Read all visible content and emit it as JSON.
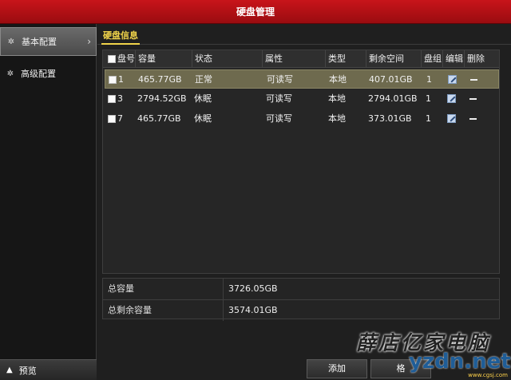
{
  "window": {
    "title": "硬盘管理"
  },
  "sidebar": {
    "items": [
      {
        "label": "基本配置",
        "active": true
      },
      {
        "label": "高级配置",
        "active": false
      }
    ],
    "preview_label": "预览"
  },
  "tabs": [
    {
      "label": "硬盘信息",
      "active": true
    }
  ],
  "table": {
    "headers": {
      "disk_no": "盘号",
      "capacity": "容量",
      "status": "状态",
      "attribute": "属性",
      "type": "类型",
      "free_space": "剩余空间",
      "group": "盘组",
      "edit": "编辑",
      "delete": "删除"
    },
    "rows": [
      {
        "disk_no": "1",
        "capacity": "465.77GB",
        "status": "正常",
        "attribute": "可读写",
        "type": "本地",
        "free_space": "407.01GB",
        "group": "1",
        "selected": true
      },
      {
        "disk_no": "3",
        "capacity": "2794.52GB",
        "status": "休眠",
        "attribute": "可读写",
        "type": "本地",
        "free_space": "2794.01GB",
        "group": "1",
        "selected": false
      },
      {
        "disk_no": "7",
        "capacity": "465.77GB",
        "status": "休眠",
        "attribute": "可读写",
        "type": "本地",
        "free_space": "373.01GB",
        "group": "1",
        "selected": false
      }
    ]
  },
  "summary": {
    "total_label": "总容量",
    "total_value": "3726.05GB",
    "free_label": "总剩余容量",
    "free_value": "3574.01GB"
  },
  "buttons": {
    "add": "添加",
    "second_partial": "格"
  },
  "watermark": {
    "text": "薛店亿家电脑",
    "url": "yzdn.net",
    "small": "www.cgsj.com"
  },
  "colors": {
    "titlebar": "#b01016",
    "tab_accent": "#f0d34a",
    "selected_row": "#6e6a4e"
  }
}
